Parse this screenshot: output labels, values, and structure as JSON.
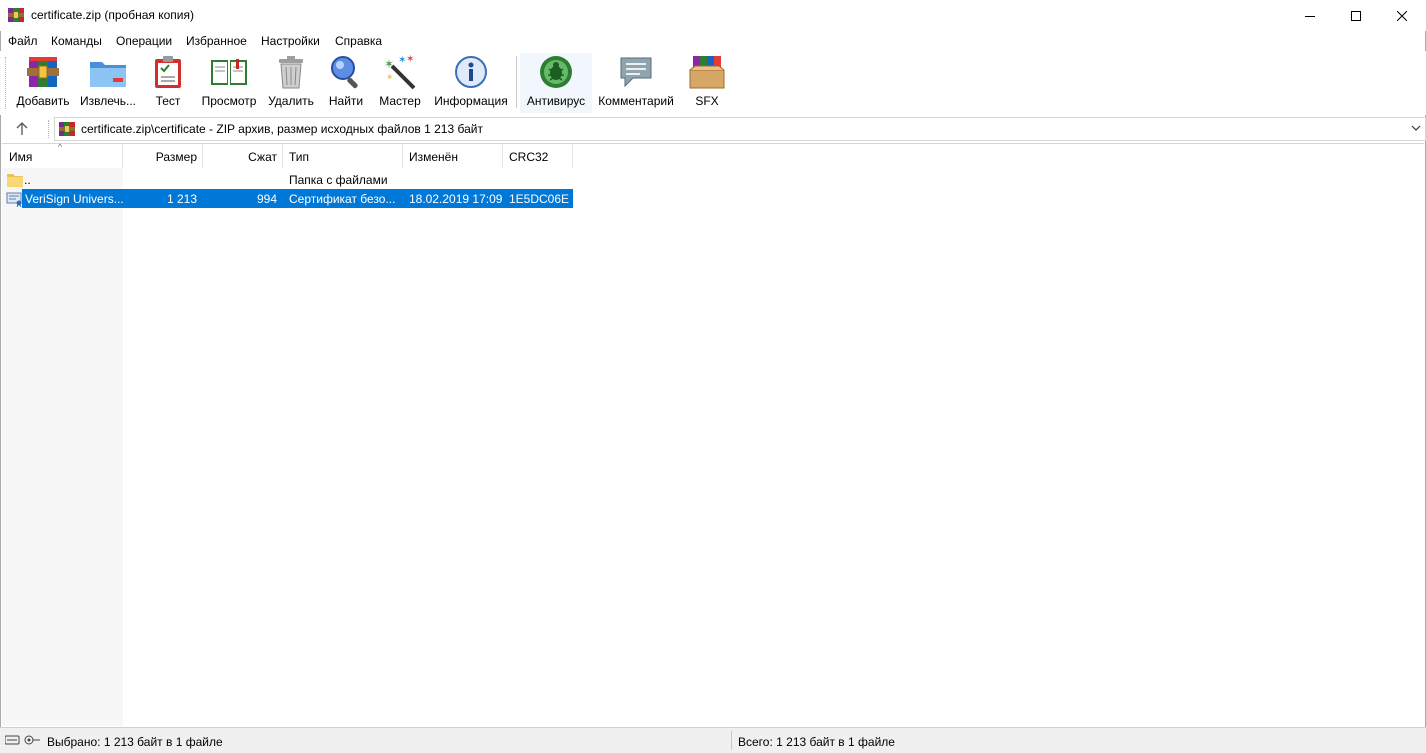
{
  "window": {
    "title": "certificate.zip (пробная копия)"
  },
  "menu": [
    "Файл",
    "Команды",
    "Операции",
    "Избранное",
    "Настройки",
    "Справка"
  ],
  "toolbar": {
    "add": "Добавить",
    "extract": "Извлечь...",
    "test": "Тест",
    "view": "Просмотр",
    "delete": "Удалить",
    "find": "Найти",
    "wizard": "Мастер",
    "info": "Информация",
    "antivirus": "Антивирус",
    "comment": "Комментарий",
    "sfx": "SFX"
  },
  "address": {
    "path": "certificate.zip\\certificate - ZIP архив, размер исходных файлов 1 213 байт"
  },
  "columns": {
    "name": "Имя",
    "size": "Размер",
    "packed": "Сжат",
    "type": "Тип",
    "modified": "Изменён",
    "crc": "CRC32"
  },
  "rows": [
    {
      "name": "..",
      "size": "",
      "packed": "",
      "type": "Папка с файлами",
      "modified": "",
      "crc": "",
      "icon": "folder-icon",
      "selected": false
    },
    {
      "name": "VeriSign Univers...",
      "size": "1 213",
      "packed": "994",
      "type": "Сертификат безо...",
      "modified": "18.02.2019 17:09",
      "crc": "1E5DC06E",
      "icon": "certificate-file-icon",
      "selected": true
    }
  ],
  "status": {
    "selected": "Выбрано: 1 213 байт в 1 файле",
    "total": "Всего: 1 213 байт в 1 файле"
  },
  "colors": {
    "selection": "#0078d7",
    "name_column_bg": "#f7f7f7",
    "status_bg": "#f0f0f0"
  }
}
